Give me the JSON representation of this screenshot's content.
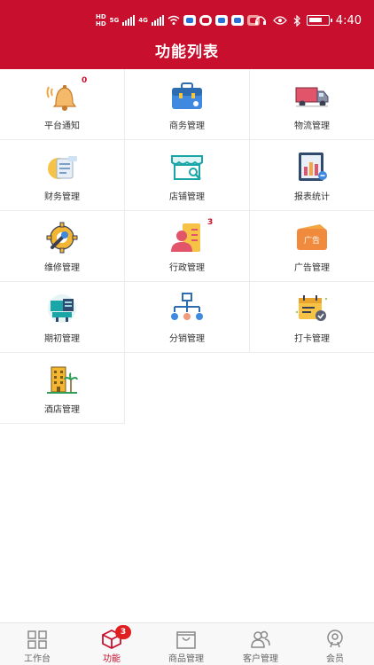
{
  "status_bar": {
    "network_label_top": "HD",
    "network_label_bottom": "HD",
    "network_5g": "5G",
    "network_4g": "4G",
    "time": "4:40"
  },
  "header": {
    "title": "功能列表"
  },
  "functions": [
    {
      "label": "平台通知",
      "icon": "bell-icon",
      "badge": "0"
    },
    {
      "label": "商务管理",
      "icon": "briefcase-icon",
      "badge": ""
    },
    {
      "label": "物流管理",
      "icon": "truck-icon",
      "badge": ""
    },
    {
      "label": "财务管理",
      "icon": "coins-icon",
      "badge": ""
    },
    {
      "label": "店铺管理",
      "icon": "store-icon",
      "badge": ""
    },
    {
      "label": "报表统计",
      "icon": "report-chart-icon",
      "badge": ""
    },
    {
      "label": "维修管理",
      "icon": "wrench-gear-icon",
      "badge": ""
    },
    {
      "label": "行政管理",
      "icon": "admin-person-icon",
      "badge": "3"
    },
    {
      "label": "广告管理",
      "icon": "ad-board-icon",
      "badge": "",
      "icon_text": "广告"
    },
    {
      "label": "期初管理",
      "icon": "opening-icon",
      "badge": ""
    },
    {
      "label": "分销管理",
      "icon": "distribution-tree-icon",
      "badge": ""
    },
    {
      "label": "打卡管理",
      "icon": "checkin-calendar-icon",
      "badge": ""
    },
    {
      "label": "酒店管理",
      "icon": "hotel-icon",
      "badge": ""
    }
  ],
  "tabbar": {
    "items": [
      {
        "label": "工作台",
        "icon": "grid-icon"
      },
      {
        "label": "功能",
        "icon": "cube-icon",
        "badge": "3"
      },
      {
        "label": "商品管理",
        "icon": "shopping-bag-icon"
      },
      {
        "label": "客户管理",
        "icon": "customers-icon"
      },
      {
        "label": "会员",
        "icon": "member-icon"
      }
    ],
    "active_index": 1
  },
  "colors": {
    "header": "#c8102e",
    "badge_text": "#c8102e",
    "tab_active": "#c8102e",
    "tab_badge": "#e02020"
  }
}
